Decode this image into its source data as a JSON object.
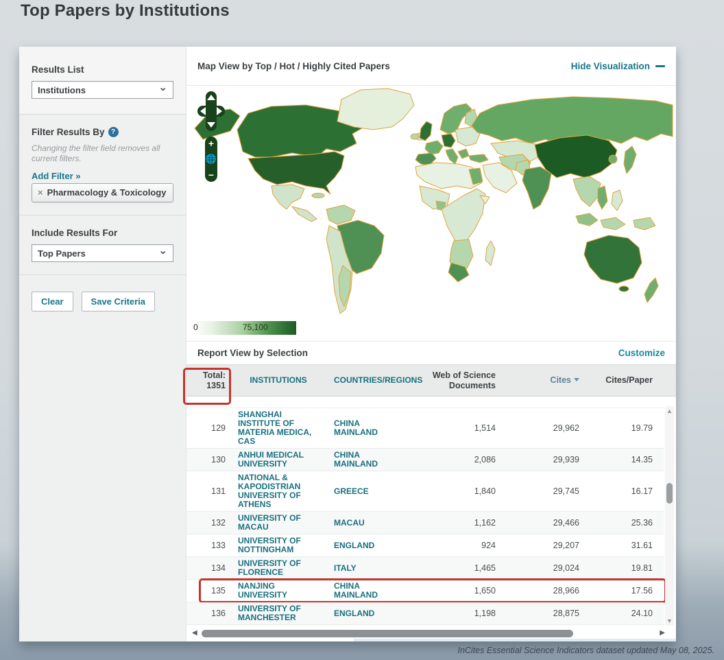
{
  "page": {
    "title": "Top Papers by Institutions",
    "footer": "InCites Essential Science Indicators dataset updated May 08, 2025."
  },
  "sidebar": {
    "results_list_label": "Results List",
    "results_list_value": "Institutions",
    "filter_label": "Filter Results By",
    "filter_help_icon": "?",
    "filter_note": "Changing the filter field removes all current filters.",
    "add_filter_label": "Add Filter »",
    "filter_tag": {
      "remove_icon": "×",
      "label": "Pharmacology & Toxicology"
    },
    "include_label": "Include Results For",
    "include_value": "Top Papers",
    "clear_button": "Clear",
    "save_button": "Save Criteria"
  },
  "map": {
    "header": "Map View by Top / Hot / Highly Cited Papers",
    "hide_link": "Hide Visualization",
    "legend": {
      "min": "0",
      "max": "75,100"
    },
    "controls": [
      "pan-up",
      "pan-left",
      "pan-right",
      "pan-down",
      "zoom-in",
      "globe",
      "zoom-out"
    ],
    "zoom_in_label": "+",
    "zoom_out_label": "−",
    "globe_icon": "🌐"
  },
  "report": {
    "header": "Report View by Selection",
    "customize_link": "Customize",
    "total_label": "Total:",
    "total_value": "1351",
    "columns": [
      "Institutions",
      "Countries/Regions",
      "Web of Science Documents",
      "Cites",
      "Cites/Paper"
    ],
    "sorted_column": "Cites",
    "rows": [
      {
        "rank": "129",
        "institution": "SHANGHAI INSTITUTE OF MATERIA MEDICA, CAS",
        "country": "CHINA MAINLAND",
        "docs": "1,514",
        "cites": "29,962",
        "cites_per_paper": "19.79",
        "highlighted": false
      },
      {
        "rank": "130",
        "institution": "ANHUI MEDICAL UNIVERSITY",
        "country": "CHINA MAINLAND",
        "docs": "2,086",
        "cites": "29,939",
        "cites_per_paper": "14.35",
        "highlighted": false
      },
      {
        "rank": "131",
        "institution": "NATIONAL & KAPODISTRIAN UNIVERSITY OF ATHENS",
        "country": "GREECE",
        "docs": "1,840",
        "cites": "29,745",
        "cites_per_paper": "16.17",
        "highlighted": false
      },
      {
        "rank": "132",
        "institution": "UNIVERSITY OF MACAU",
        "country": "MACAU",
        "docs": "1,162",
        "cites": "29,466",
        "cites_per_paper": "25.36",
        "highlighted": false
      },
      {
        "rank": "133",
        "institution": "UNIVERSITY OF NOTTINGHAM",
        "country": "ENGLAND",
        "docs": "924",
        "cites": "29,207",
        "cites_per_paper": "31.61",
        "highlighted": false
      },
      {
        "rank": "134",
        "institution": "UNIVERSITY OF FLORENCE",
        "country": "ITALY",
        "docs": "1,465",
        "cites": "29,024",
        "cites_per_paper": "19.81",
        "highlighted": false
      },
      {
        "rank": "135",
        "institution": "NANJING UNIVERSITY",
        "country": "CHINA MAINLAND",
        "docs": "1,650",
        "cites": "28,966",
        "cites_per_paper": "17.56",
        "highlighted": true
      },
      {
        "rank": "136",
        "institution": "UNIVERSITY OF MANCHESTER",
        "country": "ENGLAND",
        "docs": "1,198",
        "cites": "28,875",
        "cites_per_paper": "24.10",
        "highlighted": false
      }
    ]
  },
  "colors": {
    "accent_teal": "#17768a",
    "link_teal": "#1787a0",
    "annotation_red": "#c4342a",
    "map_scale_min": "#ffffff",
    "map_scale_max": "#1c5b23",
    "map_border_orange": "#e1a33c",
    "header_gray": "#e9ebea"
  }
}
